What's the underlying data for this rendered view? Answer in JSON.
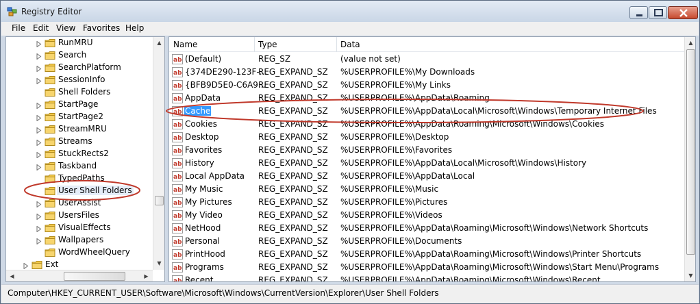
{
  "window": {
    "title": "Registry Editor"
  },
  "menu": [
    "File",
    "Edit",
    "View",
    "Favorites",
    "Help"
  ],
  "tree": {
    "items": [
      {
        "label": "RunMRU",
        "expandable": true
      },
      {
        "label": "Search",
        "expandable": true
      },
      {
        "label": "SearchPlatform",
        "expandable": true
      },
      {
        "label": "SessionInfo",
        "expandable": true
      },
      {
        "label": "Shell Folders",
        "expandable": false
      },
      {
        "label": "StartPage",
        "expandable": true
      },
      {
        "label": "StartPage2",
        "expandable": true
      },
      {
        "label": "StreamMRU",
        "expandable": true
      },
      {
        "label": "Streams",
        "expandable": true
      },
      {
        "label": "StuckRects2",
        "expandable": true
      },
      {
        "label": "Taskband",
        "expandable": true
      },
      {
        "label": "TypedPaths",
        "expandable": false
      },
      {
        "label": "User Shell Folders",
        "expandable": false,
        "selected": true
      },
      {
        "label": "UserAssist",
        "expandable": true
      },
      {
        "label": "UsersFiles",
        "expandable": true
      },
      {
        "label": "VisualEffects",
        "expandable": true
      },
      {
        "label": "Wallpapers",
        "expandable": true
      },
      {
        "label": "WordWheelQuery",
        "expandable": false
      },
      {
        "label": "Ext",
        "expandable": true,
        "level": "parent"
      }
    ]
  },
  "list": {
    "columns": [
      "Name",
      "Type",
      "Data"
    ],
    "rows": [
      {
        "name": "(Default)",
        "type": "REG_SZ",
        "data": "(value not set)"
      },
      {
        "name": "{374DE290-123F-...",
        "type": "REG_EXPAND_SZ",
        "data": "%USERPROFILE%\\My Downloads"
      },
      {
        "name": "{BFB9D5E0-C6A9...",
        "type": "REG_EXPAND_SZ",
        "data": "%USERPROFILE%\\My Links"
      },
      {
        "name": "AppData",
        "type": "REG_EXPAND_SZ",
        "data": "%USERPROFILE%\\AppData\\Roaming"
      },
      {
        "name": "Cache",
        "type": "REG_EXPAND_SZ",
        "data": "%USERPROFILE%\\AppData\\Local\\Microsoft\\Windows\\Temporary Internet Files",
        "selected": true
      },
      {
        "name": "Cookies",
        "type": "REG_EXPAND_SZ",
        "data": "%USERPROFILE%\\AppData\\Roaming\\Microsoft\\Windows\\Cookies"
      },
      {
        "name": "Desktop",
        "type": "REG_EXPAND_SZ",
        "data": "%USERPROFILE%\\Desktop"
      },
      {
        "name": "Favorites",
        "type": "REG_EXPAND_SZ",
        "data": "%USERPROFILE%\\Favorites"
      },
      {
        "name": "History",
        "type": "REG_EXPAND_SZ",
        "data": "%USERPROFILE%\\AppData\\Local\\Microsoft\\Windows\\History"
      },
      {
        "name": "Local AppData",
        "type": "REG_EXPAND_SZ",
        "data": "%USERPROFILE%\\AppData\\Local"
      },
      {
        "name": "My Music",
        "type": "REG_EXPAND_SZ",
        "data": "%USERPROFILE%\\Music"
      },
      {
        "name": "My Pictures",
        "type": "REG_EXPAND_SZ",
        "data": "%USERPROFILE%\\Pictures"
      },
      {
        "name": "My Video",
        "type": "REG_EXPAND_SZ",
        "data": "%USERPROFILE%\\Videos"
      },
      {
        "name": "NetHood",
        "type": "REG_EXPAND_SZ",
        "data": "%USERPROFILE%\\AppData\\Roaming\\Microsoft\\Windows\\Network Shortcuts"
      },
      {
        "name": "Personal",
        "type": "REG_EXPAND_SZ",
        "data": "%USERPROFILE%\\Documents"
      },
      {
        "name": "PrintHood",
        "type": "REG_EXPAND_SZ",
        "data": "%USERPROFILE%\\AppData\\Roaming\\Microsoft\\Windows\\Printer Shortcuts"
      },
      {
        "name": "Programs",
        "type": "REG_EXPAND_SZ",
        "data": "%USERPROFILE%\\AppData\\Roaming\\Microsoft\\Windows\\Start Menu\\Programs"
      },
      {
        "name": "Recent",
        "type": "REG_EXPAND_SZ",
        "data": "%USERPROFILE%\\AppData\\Roaming\\Microsoft\\Windows\\Recent"
      }
    ]
  },
  "status": {
    "path": "Computer\\HKEY_CURRENT_USER\\Software\\Microsoft\\Windows\\CurrentVersion\\Explorer\\User Shell Folders"
  },
  "colors": {
    "annotation": "#c0392b",
    "selection": "#3399ff",
    "folder": "#f2c94c"
  }
}
